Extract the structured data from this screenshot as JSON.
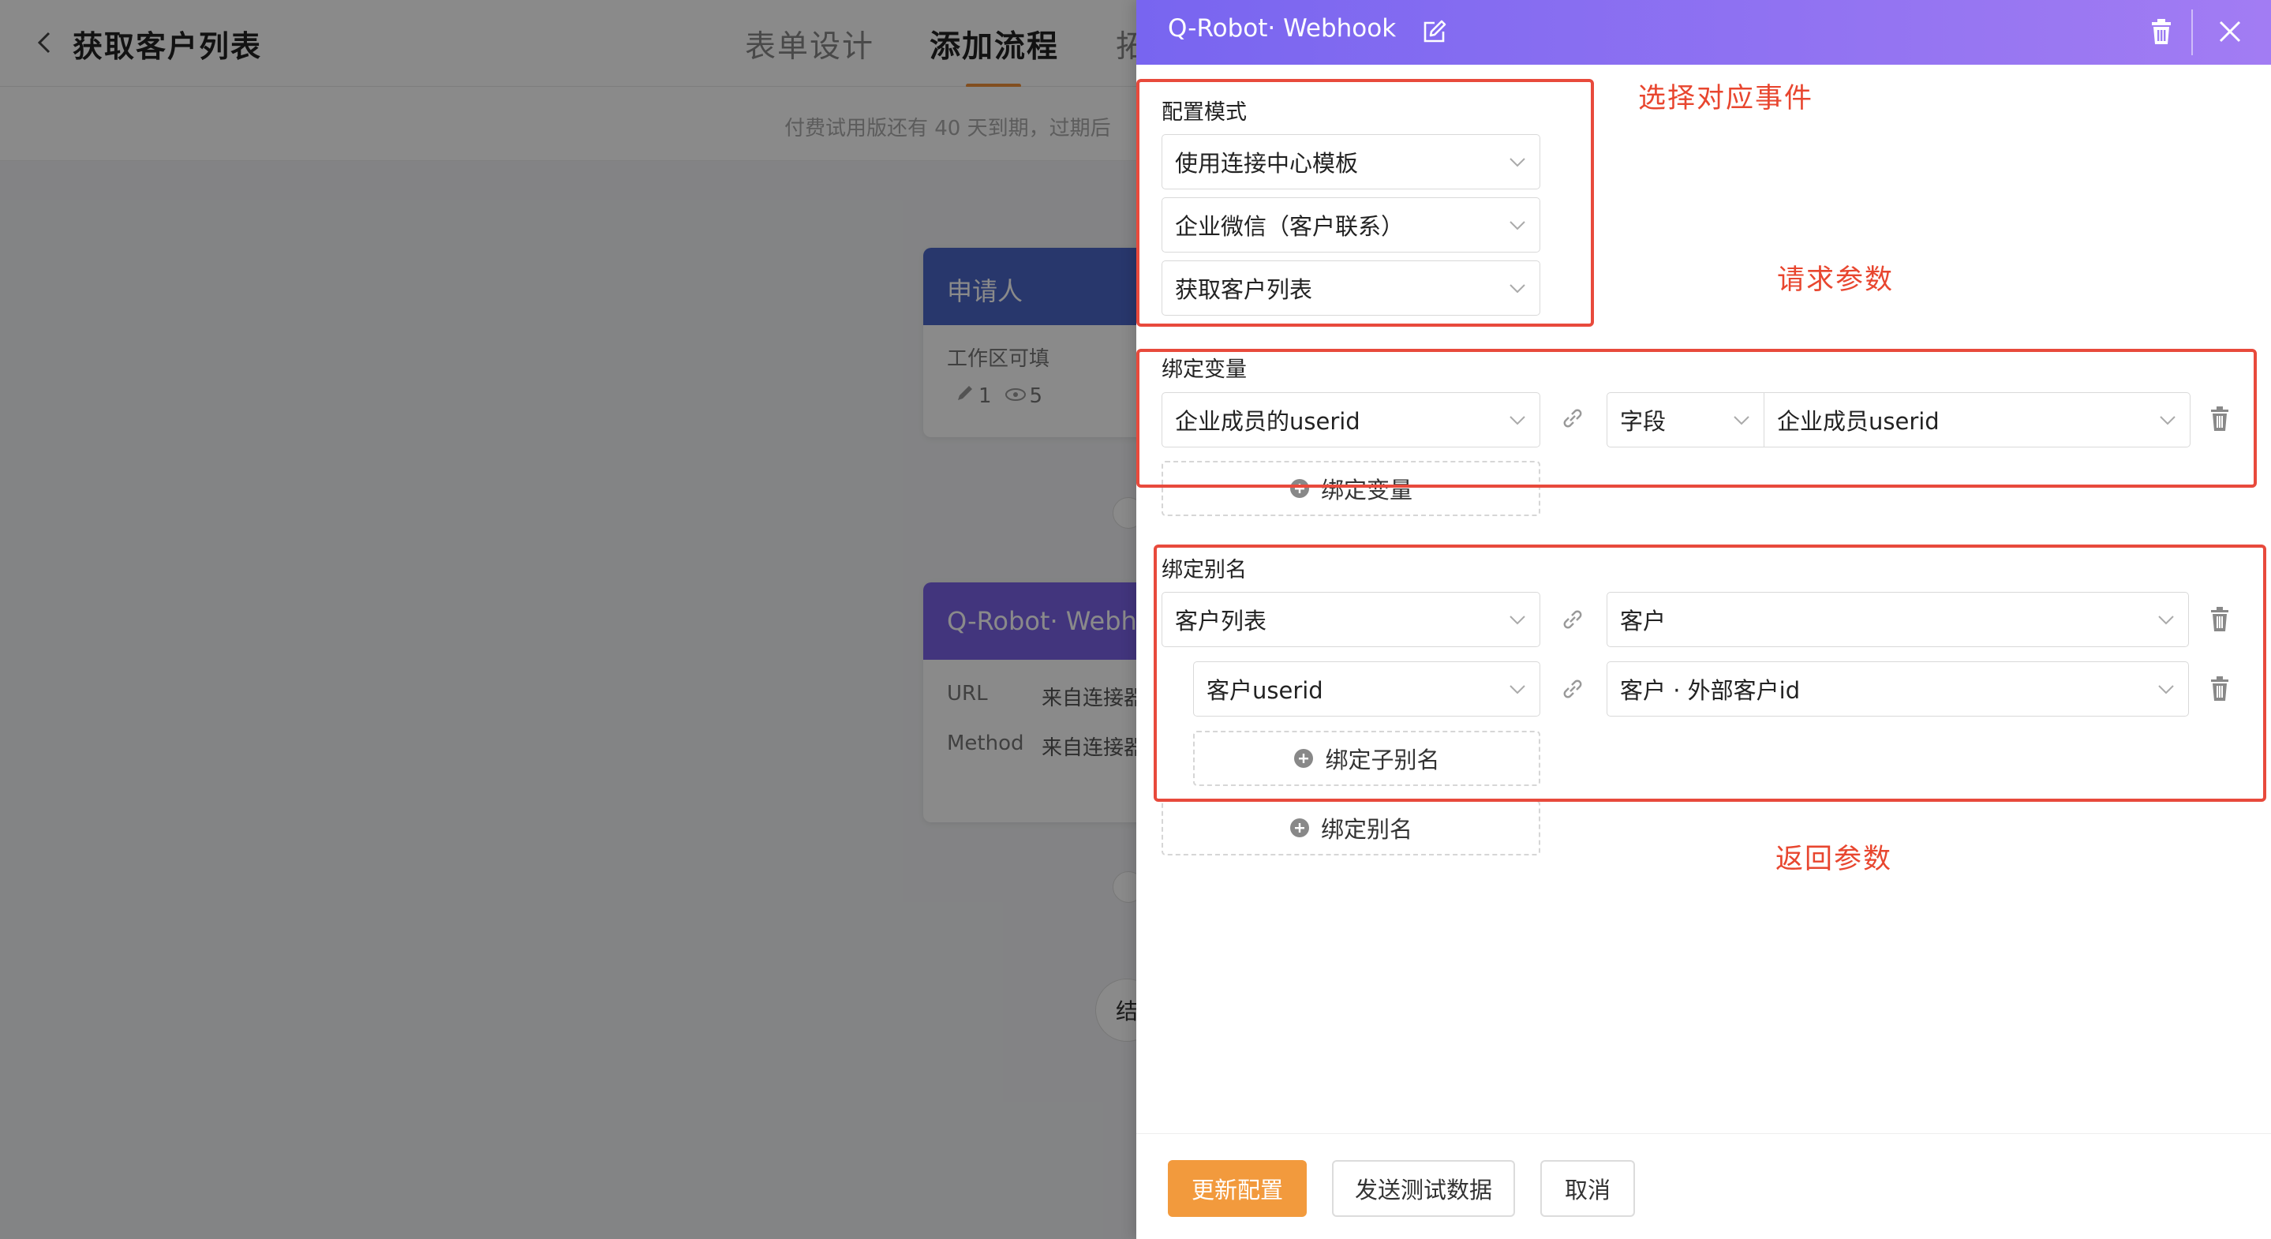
{
  "app": {
    "title": "获取客户列表",
    "tabs": [
      {
        "label": "表单设计",
        "active": false
      },
      {
        "label": "添加流程",
        "active": true
      },
      {
        "label": "拓",
        "active": false
      }
    ],
    "trial_notice": "付费试用版还有 40 天到期，过期后"
  },
  "canvas": {
    "applicant_card": {
      "title": "申请人",
      "subtitle": "工作区可填",
      "edit_count": "1",
      "view_count": "5",
      "head_color": "#4a66c8"
    },
    "webhook_card": {
      "title": "Q-Robot· Webh",
      "rows": [
        {
          "label": "URL",
          "value": "来自连接器"
        },
        {
          "label": "Method",
          "value": "来自连接器"
        }
      ],
      "head_color": "#7a62e8"
    },
    "end_node_label": "结"
  },
  "drawer": {
    "title": "Q-Robot· Webhook",
    "config_mode": {
      "label": "配置模式",
      "selects": [
        "使用连接中心模板",
        "企业微信（客户联系）",
        "获取客户列表"
      ]
    },
    "bind_variables": {
      "label": "绑定变量",
      "rows": [
        {
          "variable": "企业成员的userid",
          "source_type": "字段",
          "field": "企业成员userid"
        }
      ],
      "add_label": "绑定变量"
    },
    "bind_alias": {
      "label": "绑定别名",
      "rows": [
        {
          "alias": "客户列表",
          "target": "客户"
        }
      ],
      "sub_rows": [
        {
          "alias": "客户userid",
          "target": "客户 · 外部客户id"
        }
      ],
      "add_sub_label": "绑定子别名",
      "add_label": "绑定别名"
    },
    "buttons": {
      "update": "更新配置",
      "send_test": "发送测试数据",
      "cancel": "取消"
    }
  },
  "annotations": {
    "select_event": "选择对应事件",
    "request_params": "请求参数",
    "return_params": "返回参数",
    "color": "#e84a3c"
  },
  "colors": {
    "header_gradient_start": "#7865f0",
    "header_gradient_end": "#a27cf3",
    "primary_button": "#f29a3d",
    "tab_underline": "#f0913a"
  }
}
